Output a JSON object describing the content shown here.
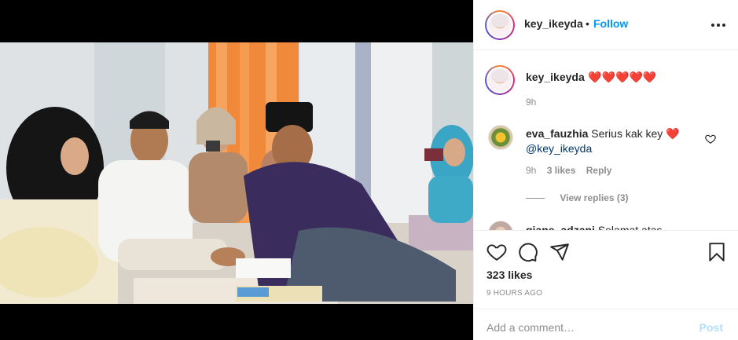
{
  "post": {
    "author": "key_ikeyda",
    "follow_label": "Follow",
    "separator": "•",
    "more_icon": "more-options-icon"
  },
  "caption": {
    "username": "key_ikeyda",
    "text": "❤️❤️❤️❤️❤️",
    "time": "9h"
  },
  "comments": [
    {
      "username": "eva_fauzhia",
      "text": "Serius kak key ❤️",
      "mention": "@key_ikeyda",
      "time": "9h",
      "likes": "3 likes",
      "reply_label": "Reply",
      "view_replies": "View replies (3)"
    },
    {
      "username": "giane_adzani",
      "text": "Selamat atas"
    }
  ],
  "actions": {
    "icons": [
      "heart-icon",
      "comment-icon",
      "share-icon",
      "bookmark-icon"
    ],
    "likes": "323 likes",
    "time_ago": "9 HOURS AGO"
  },
  "comment_box": {
    "placeholder": "Add a comment…",
    "post_label": "Post"
  },
  "colors": {
    "link_blue": "#0095f6",
    "post_disabled": "#b2dffc",
    "muted": "#8e8e8e",
    "heart_red": "#e0245e"
  }
}
